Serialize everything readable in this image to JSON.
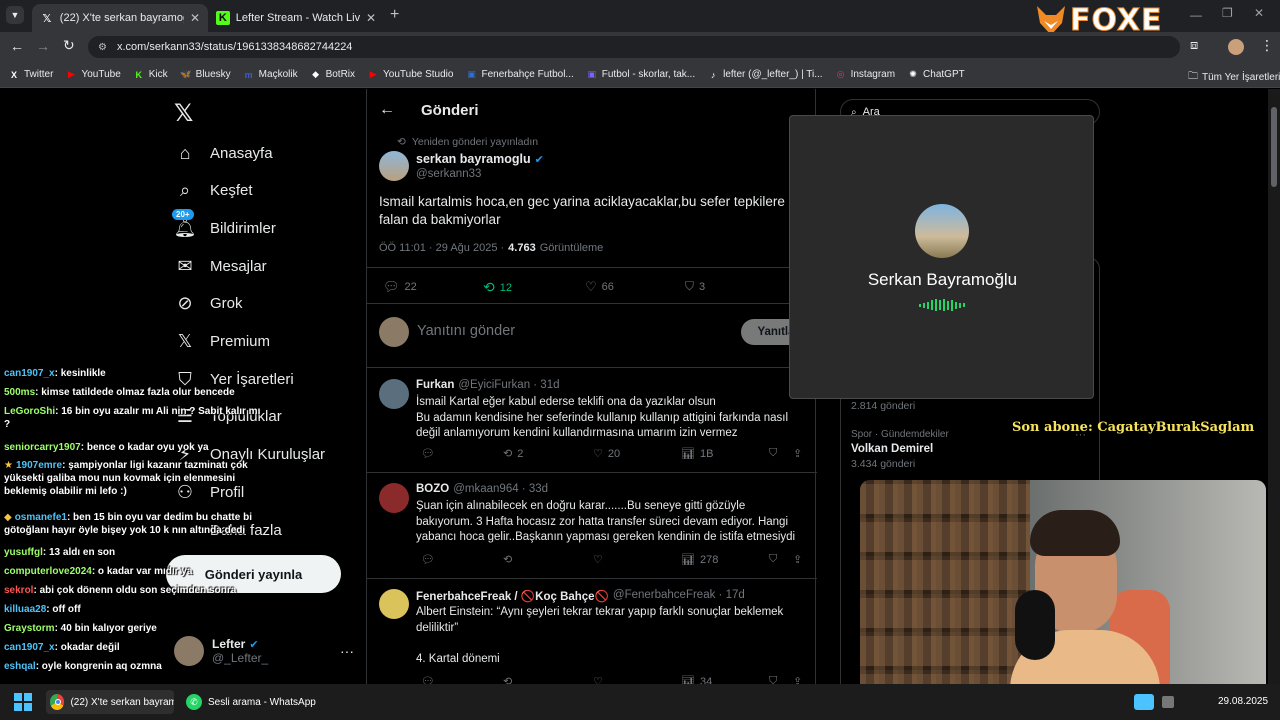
{
  "browser": {
    "tabs": [
      {
        "icon": "x-logo-icon",
        "title": "(22) X'te serkan bayramoglu: \"Is"
      },
      {
        "icon": "kick-logo-icon",
        "title": "Lefter Stream - Watch Live on K"
      }
    ],
    "url": "x.com/serkann33/status/1961338348682744224",
    "bookmarks": [
      {
        "label": "Twitter",
        "color": "#ffffff",
        "glyph": "X"
      },
      {
        "label": "YouTube",
        "color": "#ff0000",
        "glyph": "▶"
      },
      {
        "label": "Kick",
        "color": "#53fc18",
        "glyph": "K"
      },
      {
        "label": "Bluesky",
        "color": "#1185fe",
        "glyph": "🦋"
      },
      {
        "label": "Maçkolik",
        "color": "#3b5bdb",
        "glyph": "m"
      },
      {
        "label": "BotRix",
        "color": "#ffffff",
        "glyph": "◆"
      },
      {
        "label": "YouTube Studio",
        "color": "#ff0000",
        "glyph": "▶"
      },
      {
        "label": "Fenerbahçe Futbol...",
        "color": "#2f6fd6",
        "glyph": "▣"
      },
      {
        "label": "Futbol - skorlar, tak...",
        "color": "#7b61ff",
        "glyph": "▣"
      },
      {
        "label": "lefter (@_lefter_) | Ti...",
        "color": "#ffffff",
        "glyph": "♪"
      },
      {
        "label": "Instagram",
        "color": "#e1306c",
        "glyph": "◎"
      },
      {
        "label": "ChatGPT",
        "color": "#ffffff",
        "glyph": "✺"
      }
    ],
    "all_bookmarks": "Tüm Yer İşaretleri"
  },
  "stream_logo": "FOXE",
  "nav": {
    "items": [
      {
        "icon": "home-icon",
        "label": "Anasayfa"
      },
      {
        "icon": "search-icon",
        "label": "Keşfet"
      },
      {
        "icon": "bell-icon",
        "label": "Bildirimler",
        "badge": "20+"
      },
      {
        "icon": "mail-icon",
        "label": "Mesajlar"
      },
      {
        "icon": "grok-icon",
        "label": "Grok"
      },
      {
        "icon": "x-premium-icon",
        "label": "Premium"
      },
      {
        "icon": "bookmark-icon",
        "label": "Yer İşaretleri"
      },
      {
        "icon": "list-icon",
        "label": "Topluluklar"
      },
      {
        "icon": "verified-org-icon",
        "label": "Onaylı Kuruluşlar"
      },
      {
        "icon": "profile-icon",
        "label": "Profil"
      },
      {
        "icon": "more-icon",
        "label": "Daha fazla"
      }
    ],
    "post_button": "Gönderi yayınla",
    "account": {
      "name": "Lefter",
      "handle": "@_Lefter_"
    }
  },
  "header": {
    "title": "Gönderi"
  },
  "post": {
    "repost_label": "Yeniden gönderi yayınladın",
    "author": "serkan bayramoglu",
    "handle": "@serkann33",
    "text": "Ismail kartalmis hoca,en gec yarina aciklayacaklar,bu sefer tepkilere falan da bakmiyorlar",
    "time": "ÖÖ 11:01 · 29 Ağu 2025 ·",
    "views": "4.763",
    "views_label": "Görüntüleme",
    "replies": "22",
    "reposts": "12",
    "likes": "66",
    "bookmarks": "3"
  },
  "reply_box": {
    "placeholder": "Yanıtını gönder",
    "button": "Yanıtla"
  },
  "replies": [
    {
      "name": "Furkan",
      "handle": "@EyiciFurkan · 31d",
      "text": "İsmail Kartal eğer kabul ederse teklifi ona da yazıklar olsun\nBu adamın kendisine her seferinde kullanıp kullanıp attigini farkında nasıl değil anlamıyorum kendini kullandırmasına umarım izin vermez",
      "replies": "",
      "reposts": "2",
      "likes": "20",
      "views": "1B"
    },
    {
      "name": "BOZO",
      "handle": "@mkaan964 · 33d",
      "text": "Şuan için alınabilecek en doğru karar.......Bu seneye gitti gözüyle bakıyorum. 3 Hafta  hocasız zor hatta transfer süreci devam ediyor. Hangi yabancı hoca gelir..Başkanın yapması gereken kendinin de istifa etmesiydi",
      "replies": "",
      "reposts": "",
      "likes": "",
      "views": "278"
    },
    {
      "name": "FenerbahceFreak / 🚫Koç Bahçe🚫",
      "handle": "@FenerbahceFreak · 17d",
      "text": "Albert Einstein: “Aynı şeyleri tekrar tekrar yapıp farklı sonuçlar beklemek deliliktir”\n\n4. Kartal dönemi",
      "replies": "",
      "reposts": "",
      "likes": "",
      "views": "34"
    }
  ],
  "search": {
    "placeholder": "Ara"
  },
  "trends": [
    {
      "count": "2.814 gönderi"
    },
    {
      "category": "Spor · Gündemdekiler",
      "name": "Volkan Demirel",
      "count": "3.434 gönderi"
    }
  ],
  "call": {
    "name": "Serkan Bayramoğlu"
  },
  "subscriber": "Son abone: CagatayBurakSaglam",
  "chat": [
    {
      "user": "can1907_x",
      "color": "#4fc3f7",
      "msg": ": kesinlikle"
    },
    {
      "user": "500ms",
      "color": "#9eff6b",
      "msg": ": kimse tatildede olmaz fazla olur bencede"
    },
    {
      "user": "LeGoroShi",
      "color": "#9eff6b",
      "msg": ": 16 bin oyu azalır mı Ali nin ? Sabit kalır mı\n?"
    },
    {
      "user": "seniorcarry1907",
      "color": "#9eff6b",
      "msg": ": bence o kadar oyu yok ya"
    },
    {
      "user": "1907emre",
      "color": "#4fc3f7",
      "msg": ": şampiyonlar ligi kazanır tazminatı çok\nyüksekti galiba mou nun kovmak için elenmesini\nbeklemiş olabilir mi lefo :)",
      "badge": "★"
    },
    {
      "user": "osmanefe1",
      "color": "#4fc3f7",
      "msg": ": ben 15 bin oyu var dedim bu chatte bi\ngötoğlanı hayır öyle bişey yok 10 k nın altında dedi",
      "badge": "◆"
    },
    {
      "user": "yusuffgl",
      "color": "#9eff6b",
      "msg": ": 13 aldı en son"
    },
    {
      "user": "computerlove2024",
      "color": "#9eff6b",
      "msg": ": o kadar var mıdır ya"
    },
    {
      "user": "sekrol",
      "color": "#ff5252",
      "msg": ": abi çok dönenn oldu son seçimden sonra"
    },
    {
      "user": "killuaa28",
      "color": "#4fc3f7",
      "msg": ": off off"
    },
    {
      "user": "Graystorm",
      "color": "#9eff6b",
      "msg": ": 40 bin kalıyor geriye"
    },
    {
      "user": "can1907_x",
      "color": "#4fc3f7",
      "msg": ": okadar değil"
    },
    {
      "user": "eshqal",
      "color": "#4fc3f7",
      "msg": ": oyle kongrenin aq ozmna"
    }
  ],
  "taskbar": {
    "items": [
      {
        "icon": "chrome-icon",
        "label": "(22) X'te serkan bayram..."
      },
      {
        "icon": "whatsapp-icon",
        "label": "Sesli arama - WhatsApp"
      }
    ],
    "date": "29.08.2025"
  }
}
